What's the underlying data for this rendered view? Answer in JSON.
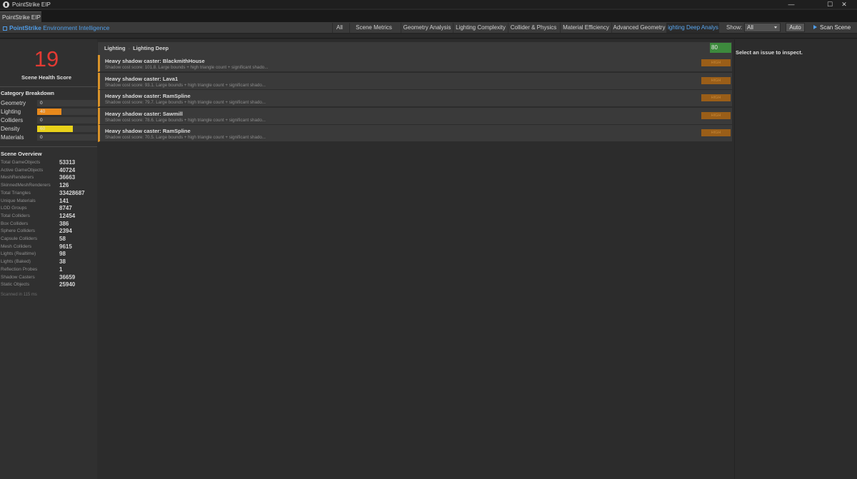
{
  "window": {
    "title": "PointStrike EIP",
    "tab_label": "PointStrike EIP",
    "minimize_glyph": "—",
    "maximize_glyph": "☐",
    "close_glyph": "✕"
  },
  "brand": {
    "name": "PointStrike",
    "subtitle": "Environment Intelligence",
    "accent": "#4f9de8"
  },
  "toolbar": {
    "tabs": [
      {
        "label": "All"
      },
      {
        "label": "Scene Metrics"
      },
      {
        "label": "Geometry Analysis"
      },
      {
        "label": "Lighting Complexity"
      },
      {
        "label": "Collider & Physics"
      },
      {
        "label": "Material Efficiency"
      },
      {
        "label": "Advanced Geometry"
      },
      {
        "label": "ighting Deep Analys"
      }
    ],
    "active_tab": "ighting Deep Analys",
    "show_label": "Show:",
    "show_value": "All",
    "auto_label": "Auto",
    "scan_label": "Scan Scene"
  },
  "sidebar": {
    "health_score": "19",
    "health_score_color": "#e33a33",
    "health_label": "Scene Health Score",
    "category_title": "Category Breakdown",
    "categories": [
      {
        "label": "Geometry",
        "value": "0",
        "fraction": 0,
        "color": "#3c3c3c"
      },
      {
        "label": "Lighting",
        "value": "40",
        "fraction": 0.4,
        "color": "#e8891c"
      },
      {
        "label": "Colliders",
        "value": "0",
        "fraction": 0,
        "color": "#3c3c3c"
      },
      {
        "label": "Density",
        "value": "60",
        "fraction": 0.6,
        "color": "#e9d21a"
      },
      {
        "label": "Materials",
        "value": "0",
        "fraction": 0,
        "color": "#3c3c3c"
      }
    ],
    "overview_title": "Scene Overview",
    "overview": [
      {
        "label": "Total GameObjects",
        "value": "53313"
      },
      {
        "label": "Active GameObjects",
        "value": "40724"
      },
      {
        "label": "MeshRenderers",
        "value": "36663"
      },
      {
        "label": "SkinnedMeshRenderers",
        "value": "126"
      },
      {
        "label": "Total Triangles",
        "value": "33428687"
      },
      {
        "label": "Unique Materials",
        "value": "141"
      },
      {
        "label": "LOD Groups",
        "value": "8747"
      },
      {
        "label": "Total Colliders",
        "value": "12454"
      },
      {
        "label": "Box Colliders",
        "value": "386"
      },
      {
        "label": "Sphere Colliders",
        "value": "2394"
      },
      {
        "label": "Capsule Colliders",
        "value": "58"
      },
      {
        "label": "Mesh Colliders",
        "value": "9615"
      },
      {
        "label": "Lights (Realtime)",
        "value": "98"
      },
      {
        "label": "Lights (Baked)",
        "value": "38"
      },
      {
        "label": "Reflection Probes",
        "value": "1"
      },
      {
        "label": "Shadow Casters",
        "value": "36659"
      },
      {
        "label": "Static Objects",
        "value": "25940"
      }
    ],
    "scanned_text": "Scanned in 115 ms"
  },
  "main": {
    "breadcrumb_root": "Lighting",
    "breadcrumb_separator": "·",
    "breadcrumb_leaf": "Lighting Deep Analysis",
    "score": "80",
    "score_color": "#3d8a3d",
    "issues": [
      {
        "title": "Heavy shadow caster: BlackmithHouse",
        "desc": "Shadow cost score: 101.8. Large bounds + high triangle count + significant shado...",
        "severity": "HIGH"
      },
      {
        "title": "Heavy shadow caster: Lava1",
        "desc": "Shadow cost score: 93.1. Large bounds + high triangle count + significant shado...",
        "severity": "HIGH"
      },
      {
        "title": "Heavy shadow caster: RamSpline",
        "desc": "Shadow cost score: 79.7. Large bounds + high triangle count + significant shado...",
        "severity": "HIGH"
      },
      {
        "title": "Heavy shadow caster: Sawmill",
        "desc": "Shadow cost score: 78.6. Large bounds + high triangle count + significant shado...",
        "severity": "HIGH"
      },
      {
        "title": "Heavy shadow caster: RamSpline",
        "desc": "Shadow cost score: 70.5. Large bounds + high triangle count + significant shado...",
        "severity": "HIGH"
      }
    ]
  },
  "inspector": {
    "placeholder": "Select an issue to inspect."
  }
}
